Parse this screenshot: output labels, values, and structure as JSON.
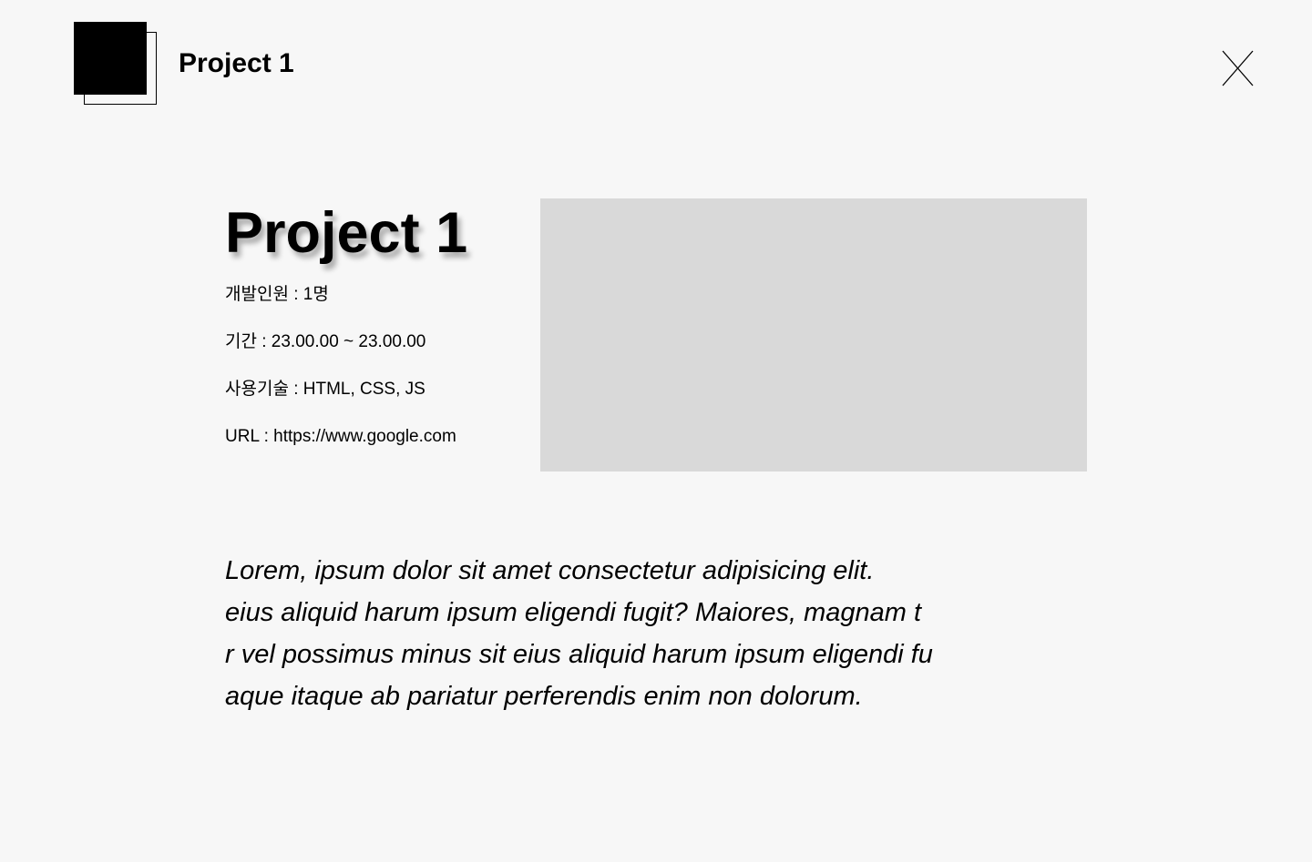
{
  "header": {
    "title": "Project 1"
  },
  "project": {
    "title": "Project 1",
    "info": {
      "members": "개발인원 : 1명",
      "period": "기간 : 23.00.00 ~ 23.00.00",
      "stack": "사용기술 : HTML, CSS, JS",
      "url_label": "URL : ",
      "url": "https://www.google.com"
    },
    "preview_color": "#d9d9d9",
    "description": {
      "line1": "Lorem, ipsum dolor sit amet consectetur adipisicing elit.",
      "line2": "eius aliquid harum ipsum eligendi fugit? Maiores, magnam t",
      "line3": "r vel possimus minus sit eius aliquid harum ipsum eligendi fu",
      "line4": "aque itaque ab pariatur perferendis enim non dolorum."
    }
  },
  "icons": {
    "logo": "logo-icon",
    "close": "close-icon"
  },
  "colors": {
    "background": "#f7f7f7",
    "text": "#000000",
    "placeholder": "#d9d9d9"
  }
}
